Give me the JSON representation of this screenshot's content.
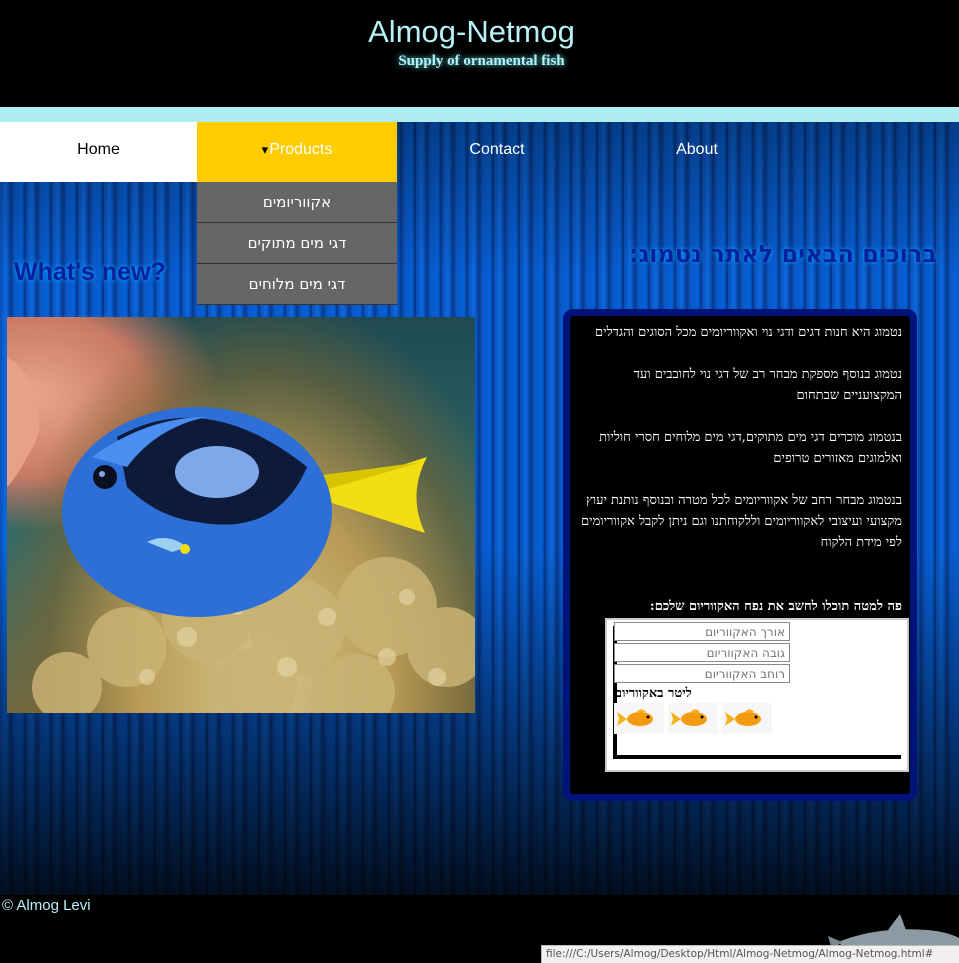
{
  "header": {
    "title": "Almog-Netmog",
    "subtitle": "Supply of ornamental fish"
  },
  "nav": {
    "items": [
      {
        "label": "Home"
      },
      {
        "caret": "▾",
        "label": "Products"
      },
      {
        "label": "Contact"
      },
      {
        "label": "About"
      }
    ],
    "dropdown": [
      {
        "label": "אקווריומים"
      },
      {
        "label": "דגי מים מתוקים"
      },
      {
        "label": "דגי מים מלוחים"
      }
    ]
  },
  "main": {
    "whats_new": "What's new?",
    "welcome": "ברוכים הבאים לאתר נטמוג:",
    "info_paragraphs": [
      "נטמוג היא חנות דגים ודגי נוי ואקווריומים מכל הסוגים והגדלים",
      "נטמוג בנוסף מספקת מבחר רב של דגי נוי לחובבים ועד המקצועניים שבתחום",
      "בנטמוג מוכרים דגי מים מתוקים,דגי מים מלוחים חסרי חוליות ואלמוגים מאזורים טרופים",
      "בנטמוג מבחר רחב של אקווריומים לכל מטרה ובנוסף נותנת יעוץ מקצועי ועיצובי לאקווריומים וללקוחתנו וגם ניתן לקבל אקווריומים לפי מידת הלקוח"
    ],
    "calc": {
      "title": "פה למטה תוכלו לחשב את נפח האקווריום שלכם:",
      "length_placeholder": "אורך האקווריום",
      "height_placeholder": "גובה האקווריום",
      "width_placeholder": "רוחב האקווריום",
      "liter_label": "ליטר באקווריום"
    }
  },
  "footer": {
    "copyright": "© Almog Levi"
  },
  "status_bar": {
    "url": "file:///C:/Users/Almog/Desktop/Html/Almog-Netmog/Almog-Netmog.html#"
  },
  "colors": {
    "accent_yellow": "#ffcc00",
    "cyan_text": "#b8f0f8",
    "heading_blue": "#0b1e9c"
  }
}
